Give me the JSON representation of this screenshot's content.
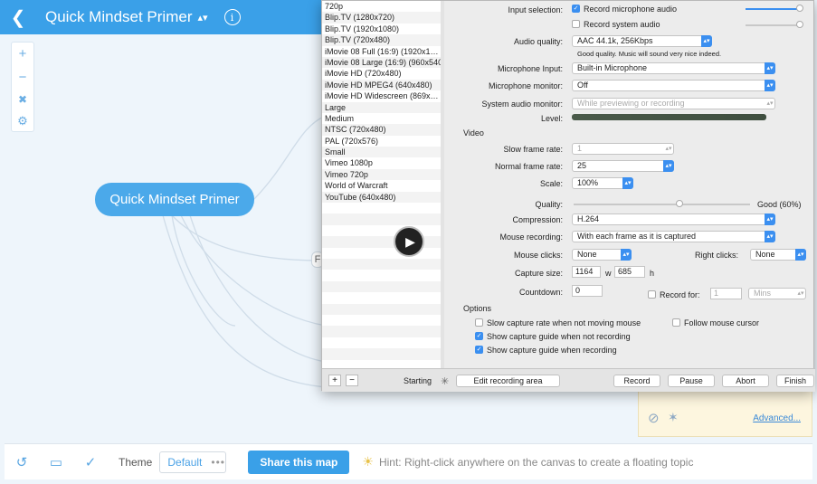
{
  "app": {
    "title": "Quick Mindset Primer",
    "back_icon": "chevron-left-icon",
    "info_icon": "info-icon",
    "central_node": "Quick Mindset Primer",
    "accent_color": "#3aa0e8"
  },
  "bottom": {
    "theme_label": "Theme",
    "theme_value": "Default",
    "theme_more": "•••",
    "share_label": "Share this map",
    "hint": "Hint: Right-click anywhere on the canvas to create a floating topic",
    "advanced_link": "Advanced..."
  },
  "node_stub_letter": "F",
  "presets": [
    "720p",
    "Blip.TV (1280x720)",
    "Blip.TV (1920x1080)",
    "Blip.TV (720x480)",
    "iMovie 08 Full (16:9) (1920x1…",
    "iMovie 08 Large (16:9) (960x540)",
    "iMovie HD (720x480)",
    "iMovie HD MPEG4 (640x480)",
    "iMovie HD Widescreen (869x…",
    "Large",
    "Medium",
    "NTSC (720x480)",
    "PAL (720x576)",
    "Small",
    "Vimeo 1080p",
    "Vimeo 720p",
    "World of Warcraft",
    "YouTube (640x480)"
  ],
  "settings": {
    "input_selection_label": "Input selection:",
    "record_mic_audio": "Record microphone audio",
    "record_system_audio": "Record system audio",
    "audio_quality_label": "Audio quality:",
    "audio_quality_value": "AAC 44.1k, 256Kbps",
    "audio_quality_note": "Good quality. Music will sound very nice indeed.",
    "mic_input_label": "Microphone Input:",
    "mic_input_value": "Built-in Microphone",
    "mic_monitor_label": "Microphone monitor:",
    "mic_monitor_value": "Off",
    "sys_monitor_label": "System audio monitor:",
    "sys_monitor_value": "While previewing or recording",
    "level_label": "Level:",
    "video_section": "Video",
    "slow_rate_label": "Slow frame rate:",
    "slow_rate_value": "1",
    "normal_rate_label": "Normal frame rate:",
    "normal_rate_value": "25",
    "scale_label": "Scale:",
    "scale_value": "100%",
    "quality_label": "Quality:",
    "quality_value_text": "Good (60%)",
    "quality_level": 0.6,
    "compression_label": "Compression:",
    "compression_value": "H.264",
    "mouse_recording_label": "Mouse recording:",
    "mouse_recording_value": "With each frame as it is captured",
    "mouse_clicks_label": "Mouse clicks:",
    "mouse_clicks_value": "None",
    "right_clicks_label": "Right clicks:",
    "right_clicks_value": "None",
    "capture_size_label": "Capture size:",
    "capture_w": "1164",
    "w_label": "w",
    "capture_h": "685",
    "h_label": "h",
    "countdown_label": "Countdown:",
    "countdown_value": "0",
    "record_for_label": "Record for:",
    "record_for_value": "1",
    "record_for_unit": "Mins",
    "options_section": "Options",
    "opt_slow_capture": "Slow capture rate when not moving mouse",
    "opt_follow_cursor": "Follow mouse cursor",
    "opt_guide_not_rec": "Show capture guide when not recording",
    "opt_guide_rec": "Show capture guide when recording"
  },
  "footer": {
    "add": "+",
    "remove": "−",
    "status": "Starting",
    "edit_area": "Edit recording area",
    "record": "Record",
    "pause": "Pause",
    "abort": "Abort",
    "finish": "Finish"
  }
}
